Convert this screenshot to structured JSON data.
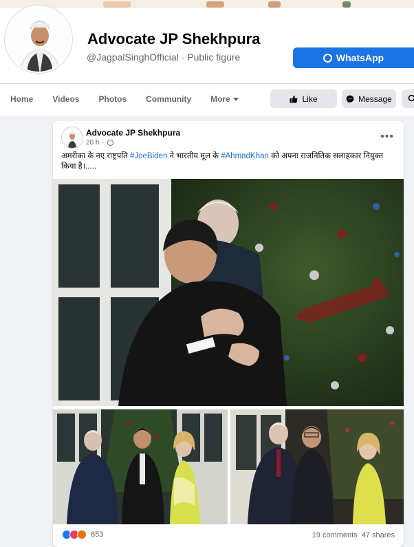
{
  "page": {
    "name": "Advocate JP Shekhpura",
    "handle": "@JagpalSinghOfficial",
    "separator": "·",
    "category": "Public figure",
    "whatsapp_label": "WhatsApp"
  },
  "nav": {
    "tabs": [
      {
        "label": "Home"
      },
      {
        "label": "Videos"
      },
      {
        "label": "Photos"
      },
      {
        "label": "Community"
      },
      {
        "label": "More"
      }
    ],
    "like_label": "Like",
    "message_label": "Message"
  },
  "post": {
    "author": "Advocate JP Shekhpura",
    "time": "20 h",
    "dot": "·",
    "text_part1": "अमरीका के नए राष्ट्रपति ",
    "hashtag1": "#JoeBiden",
    "text_part2": " ने भारतीय मूल के ",
    "hashtag2": "#AhmadKhan",
    "text_part3": " को अपना राजनितिक सलाहकार नियुक्त किया है।.....",
    "reaction_count": "653",
    "comments": "19 comments",
    "shares": "47 shares"
  },
  "colors": {
    "accent": "#1b74e4",
    "hashtag": "#216fdb",
    "muted": "#65676b",
    "button_bg": "#e4e6eb"
  },
  "icons": {
    "whatsapp": "whatsapp-icon",
    "like": "thumbs-up-icon",
    "message": "messenger-icon",
    "search": "search-icon",
    "more_caret": "chevron-down-icon",
    "privacy": "globe-icon",
    "options": "more-options-icon"
  }
}
